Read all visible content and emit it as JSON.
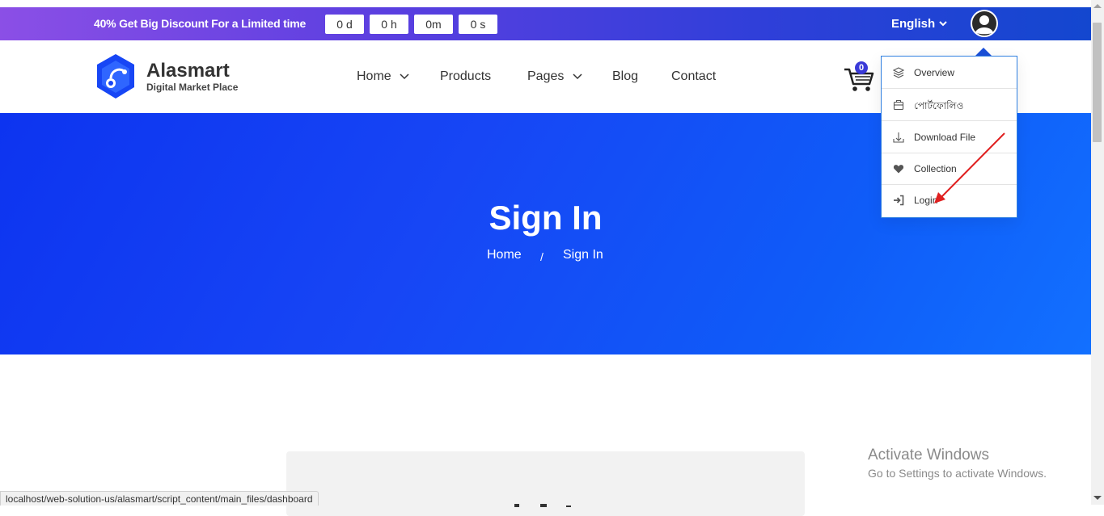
{
  "topbar": {
    "promo_bold": "40%",
    "promo_text": " Get Big Discount For a Limited time",
    "countdown": [
      "0 d",
      "0 h",
      "0m",
      "0 s"
    ],
    "language": "English"
  },
  "header": {
    "brand": "Alasmart",
    "tagline": "Digital Market Place",
    "nav": [
      "Home",
      "Products",
      "Pages",
      "Blog",
      "Contact"
    ],
    "cart_count": "0"
  },
  "hero": {
    "title": "Sign In",
    "breadcrumb_home": "Home",
    "breadcrumb_sep": "/",
    "breadcrumb_current": "Sign In"
  },
  "dropdown": {
    "items": [
      {
        "label": "Overview",
        "icon": "layers-icon"
      },
      {
        "label": "পোর্টফোলিও",
        "icon": "briefcase-icon"
      },
      {
        "label": "Download File",
        "icon": "download-icon"
      },
      {
        "label": "Collection",
        "icon": "heart-icon"
      },
      {
        "label": "Login",
        "icon": "sign-in-icon"
      }
    ]
  },
  "card": {
    "peek_text": "Login"
  },
  "windows_notice": {
    "title": "Activate Windows",
    "subtitle": "Go to Settings to activate Windows."
  },
  "statusbar": {
    "url": "localhost/web-solution-us/alasmart/script_content/main_files/dashboard"
  },
  "colors": {
    "accent": "#1746f5",
    "topbar_start": "#8b4fe6",
    "topbar_end": "#1347cf",
    "annotation": "#e02020"
  }
}
